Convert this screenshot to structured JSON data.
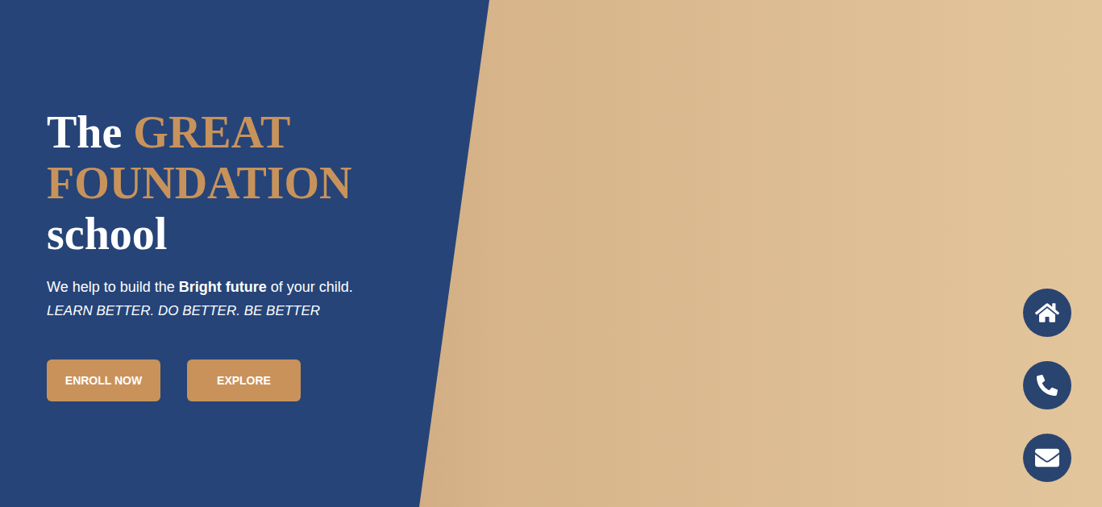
{
  "hero": {
    "title_lines": [
      [
        {
          "text": "The",
          "highlight": false
        },
        {
          "text": "GREAT",
          "highlight": true
        }
      ],
      [
        {
          "text": "FOUNDATION",
          "highlight": true
        }
      ],
      [
        {
          "text": "school",
          "highlight": false
        }
      ]
    ],
    "tagline": [
      {
        "text": "We help to build the ",
        "bold": false
      },
      {
        "text": "Bright future",
        "bold": true
      },
      {
        "text": " of your child.",
        "bold": false
      }
    ],
    "motto": "LEARN BETTER. DO BETTER. BE BETTER",
    "buttons": [
      "ENROLL NOW",
      "EXPLORE"
    ]
  }
}
